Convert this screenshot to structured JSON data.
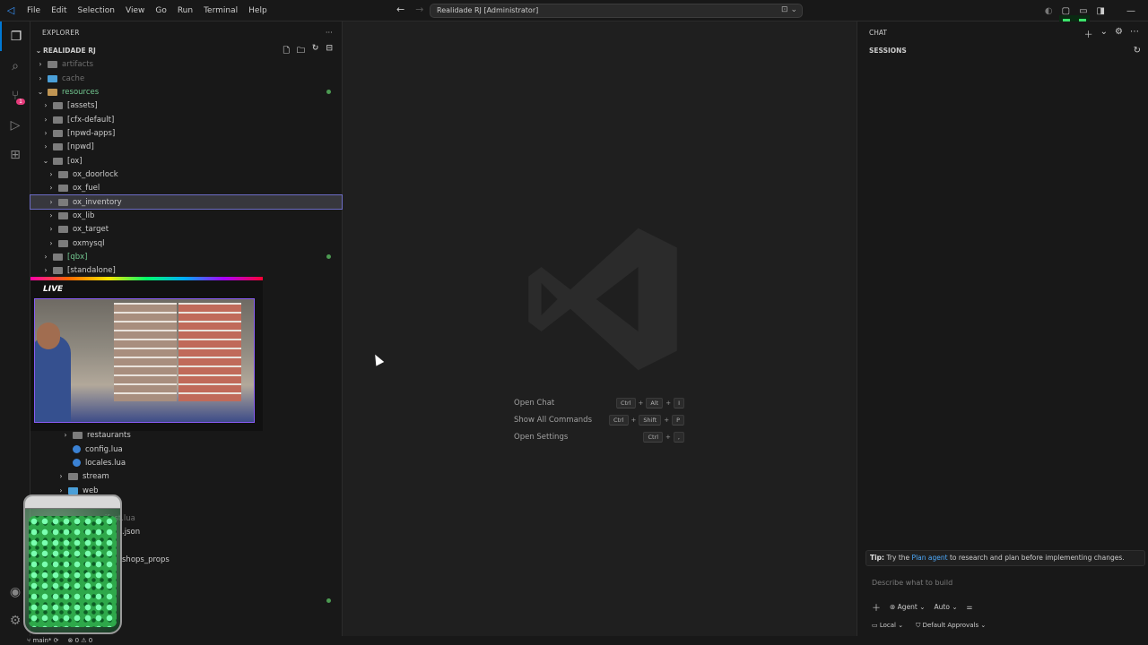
{
  "titlebar": {
    "logo": "◁",
    "menu": [
      "File",
      "Edit",
      "Selection",
      "View",
      "Go",
      "Run",
      "Terminal",
      "Help"
    ],
    "window_title": "Realidade RJ [Administrator]"
  },
  "activity_bar": {
    "scm_badge": "1"
  },
  "explorer": {
    "header": "EXPLORER",
    "more": "···",
    "section": "REALIDADE RJ",
    "tree": [
      {
        "label": "artifacts",
        "indent": 1
      },
      {
        "label": "cache",
        "indent": 1
      },
      {
        "label": "resources",
        "indent": 1
      },
      {
        "label": "[assets]",
        "indent": 2
      },
      {
        "label": "[cfx-default]",
        "indent": 2
      },
      {
        "label": "[npwd-apps]",
        "indent": 2
      },
      {
        "label": "[npwd]",
        "indent": 2
      },
      {
        "label": "[ox]",
        "indent": 2
      },
      {
        "label": "ox_doorlock",
        "indent": 3
      },
      {
        "label": "ox_fuel",
        "indent": 3
      },
      {
        "label": "ox_inventory",
        "indent": 3
      },
      {
        "label": "ox_lib",
        "indent": 3
      },
      {
        "label": "ox_target",
        "indent": 3
      },
      {
        "label": "oxmysql",
        "indent": 3
      },
      {
        "label": "[qbx]",
        "indent": 2
      },
      {
        "label": "[standalone]",
        "indent": 2
      },
      {
        "label": "restaurants",
        "indent": 4
      },
      {
        "label": "config.lua",
        "indent": 5
      },
      {
        "label": "locales.lua",
        "indent": 5
      },
      {
        "label": "stream",
        "indent": 4
      },
      {
        "label": "web",
        "indent": 4
      },
      {
        "label": "manifest.lua",
        "indent": 4
      },
      {
        "label": ".json",
        "indent": 4
      },
      {
        "label": "shops_props",
        "indent": 4
      }
    ]
  },
  "webcam": {
    "live_label": "LIVE"
  },
  "editor": {
    "commands": [
      {
        "label": "Open Chat",
        "keys": [
          "Ctrl",
          "Alt",
          "I"
        ]
      },
      {
        "label": "Show All Commands",
        "keys": [
          "Ctrl",
          "Shift",
          "P"
        ]
      },
      {
        "label": "Open Settings",
        "keys": [
          "Ctrl",
          ","
        ]
      }
    ]
  },
  "chat": {
    "title": "CHAT",
    "sessions": "SESSIONS",
    "tip_label": "Tip:",
    "tip_pre": "Try the",
    "tip_link": "Plan agent",
    "tip_post": "to research and plan before implementing changes.",
    "input_placeholder": "Describe what to build",
    "mode": "Agent",
    "model": "Auto",
    "location": "Local",
    "approvals": "Default Approvals"
  },
  "statusbar": {
    "branch": "main*",
    "problems": "⊗ 0 ⚠ 0"
  },
  "colors": {
    "accent": "#0078d4",
    "selection": "#37373d",
    "link": "#4daafc"
  }
}
